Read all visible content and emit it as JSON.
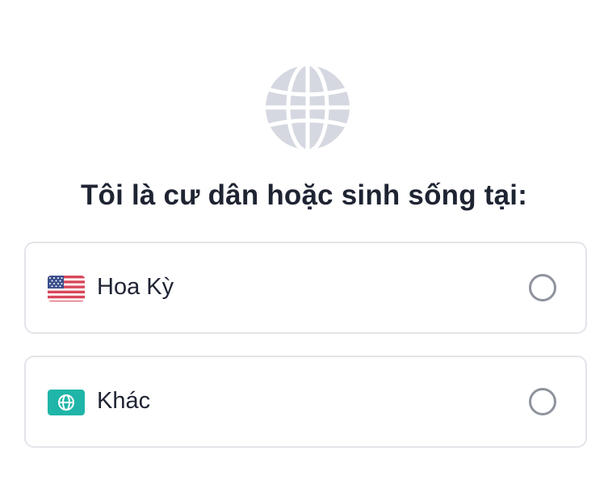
{
  "header": {
    "icon": "globe-icon",
    "icon_color": "#d5d8e0",
    "title": "Tôi là cư dân hoặc sinh sống tại:"
  },
  "options": [
    {
      "label": "Hoa Kỳ",
      "icon": "us-flag-icon",
      "selected": false
    },
    {
      "label": "Khác",
      "icon": "globe-badge-icon",
      "badge_color": "#1fb5a8",
      "selected": false
    }
  ],
  "colors": {
    "text": "#1f2433",
    "border": "#e3e5ea",
    "radio_border": "#8e939d"
  }
}
